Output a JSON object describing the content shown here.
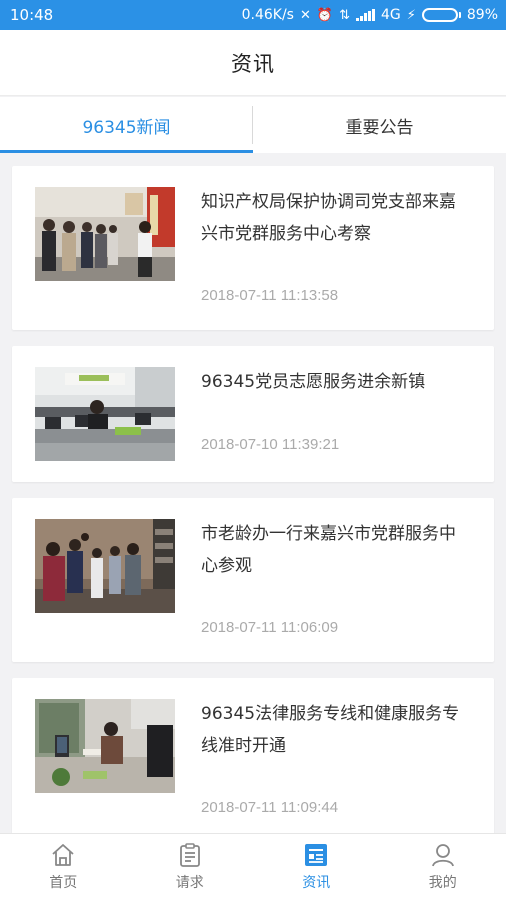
{
  "status_bar": {
    "time": "10:48",
    "speed": "0.46K/s",
    "network": "4G",
    "battery": "89%",
    "battery_level": 0.89
  },
  "header": {
    "title": "资讯"
  },
  "tabs": [
    {
      "label": "96345新闻",
      "active": true
    },
    {
      "label": "重要公告",
      "active": false
    }
  ],
  "news": [
    {
      "title": "知识产权局保护协调司党支部来嘉兴市党群服务中心考察",
      "time": "2018-07-11 11:13:58",
      "thumb": "visit-photo"
    },
    {
      "title": "96345党员志愿服务进余新镇",
      "time": "2018-07-10 11:39:21",
      "thumb": "office-photo"
    },
    {
      "title": "市老龄办一行来嘉兴市党群服务中心参观",
      "time": "2018-07-11 11:06:09",
      "thumb": "group-photo"
    },
    {
      "title": "96345法律服务专线和健康服务专线准时开通",
      "time": "2018-07-11 11:09:44",
      "thumb": "desk-photo"
    }
  ],
  "bottom_nav": [
    {
      "label": "首页",
      "icon": "home-icon",
      "active": false
    },
    {
      "label": "请求",
      "icon": "request-icon",
      "active": false
    },
    {
      "label": "资讯",
      "icon": "news-icon",
      "active": true
    },
    {
      "label": "我的",
      "icon": "profile-icon",
      "active": false
    }
  ],
  "colors": {
    "accent": "#2b8fe3",
    "status_bar": "#2b91e6",
    "battery": "#55e35b"
  }
}
